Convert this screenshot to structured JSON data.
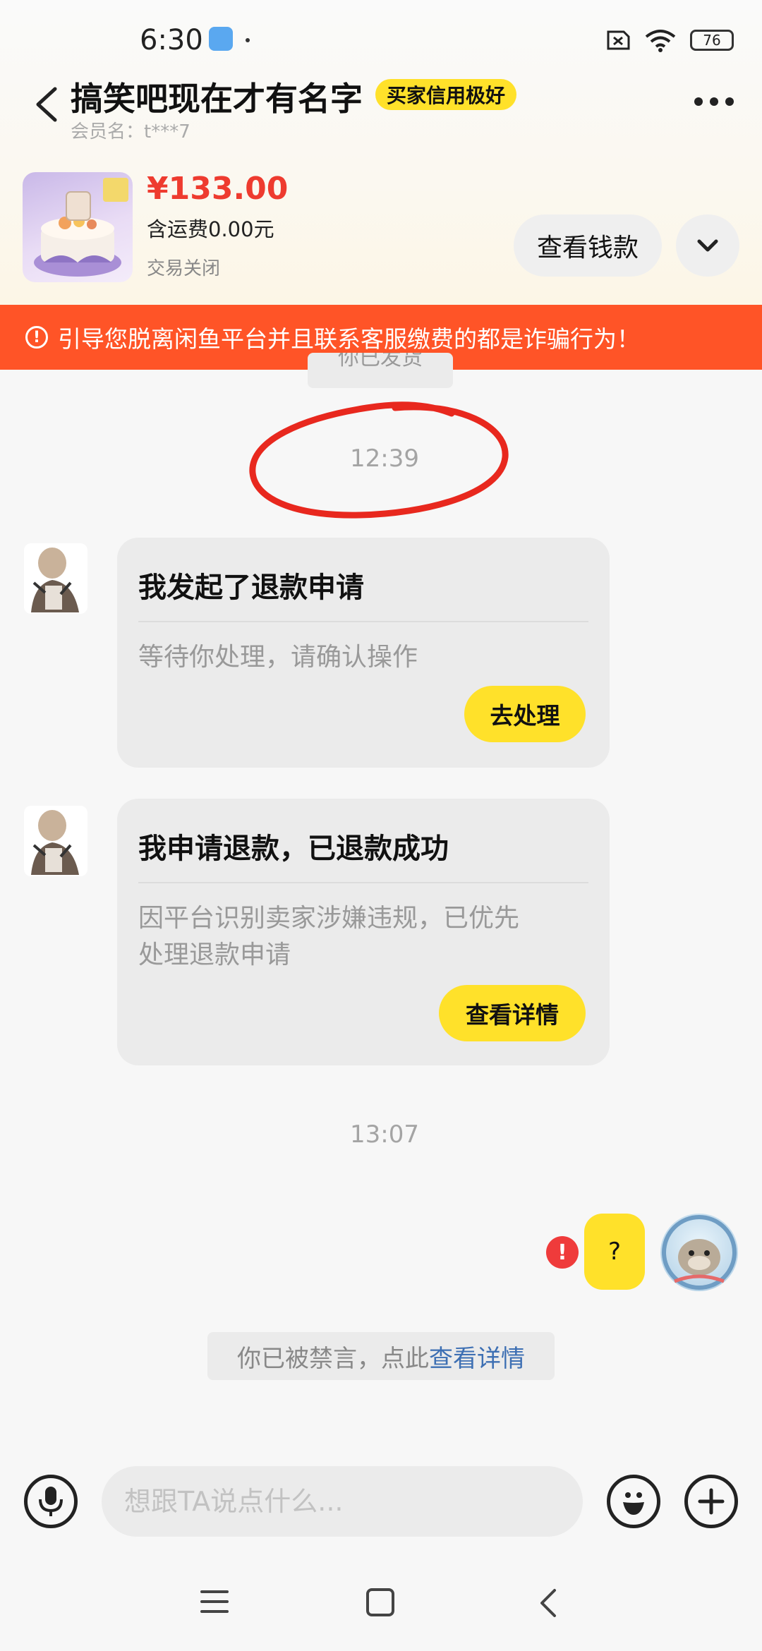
{
  "status_bar": {
    "time": "6:30",
    "battery": "76"
  },
  "header": {
    "title": "搞笑吧现在才有名字",
    "badge": "买家信用极好",
    "member_label": "会员名：t***7"
  },
  "product": {
    "price": "¥133.00",
    "shipping": "含运费0.00元",
    "status": "交易关闭",
    "view_payment_label": "查看钱款"
  },
  "warning": {
    "text": "引导您脱离闲鱼平台并且联系客服缴费的都是诈骗行为！"
  },
  "chat": {
    "system_partial": "你已发货",
    "time1": "12:39",
    "card1": {
      "title": "我发起了退款申请",
      "desc": "等待你处理，请确认操作",
      "button": "去处理"
    },
    "card2": {
      "title": "我申请退款，已退款成功",
      "desc_line1": "因平台识别卖家涉嫌违规，已优先",
      "desc_line2": "处理退款申请",
      "button": "查看详情"
    },
    "time2": "13:07",
    "my_message": "?",
    "muted_notice": "你已被禁言，点此",
    "muted_link": "查看详情"
  },
  "input_bar": {
    "placeholder": "想跟TA说点什么..."
  },
  "colors": {
    "accent_yellow": "#ffe12a",
    "warning_orange": "#ff5427",
    "price_red": "#ee3b2f",
    "link_blue": "#3d6fb3"
  }
}
